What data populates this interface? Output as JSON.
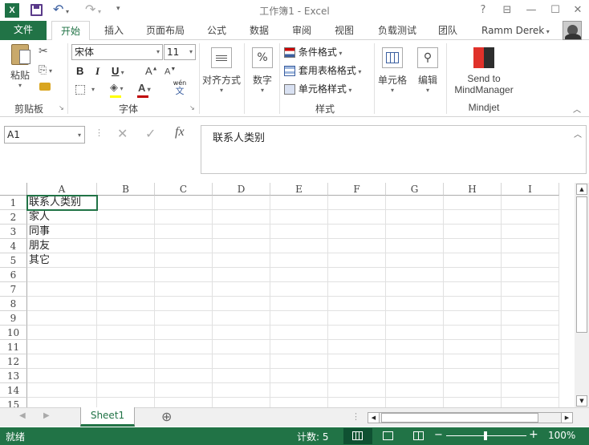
{
  "window": {
    "title": "工作簿1 - Excel",
    "help": "?",
    "minimize": "—",
    "restore": "☐",
    "close": "✕",
    "restore_ribbon": "⊟"
  },
  "tabs": {
    "file": "文件",
    "home": "开始",
    "insert": "插入",
    "layout": "页面布局",
    "formulas": "公式",
    "data": "数据",
    "review": "审阅",
    "view": "视图",
    "loadtest": "负载测试",
    "team": "团队"
  },
  "user": {
    "name": "Ramm Derek"
  },
  "ribbon": {
    "paste": "粘贴",
    "clipboard": "剪贴板",
    "font_name": "宋体",
    "font_size": "11",
    "bold": "B",
    "italic": "I",
    "underline": "U",
    "grow": "A",
    "shrink": "A",
    "font": "字体",
    "wen": "wén",
    "wen_char": "文",
    "align": "对齐方式",
    "number": "数字",
    "percent": "%",
    "cond_format": "条件格式",
    "table_format": "套用表格格式",
    "cell_style": "单元格样式",
    "styles": "样式",
    "cells": "单元格",
    "edit": "编辑",
    "send_to_line1": "Send to",
    "send_to_line2": "MindManager",
    "mindjet": "Mindjet"
  },
  "formula": {
    "namebox": "A1",
    "fx": "fx",
    "content": "联系人类别"
  },
  "columns": [
    "A",
    "B",
    "C",
    "D",
    "E",
    "F",
    "G",
    "H",
    "I"
  ],
  "rows": [
    "1",
    "2",
    "3",
    "4",
    "5",
    "6",
    "7",
    "8",
    "9",
    "10",
    "11",
    "12",
    "13",
    "14",
    "15"
  ],
  "cells": {
    "A1": "联系人类别",
    "A2": "家人",
    "A3": "同事",
    "A4": "朋友",
    "A5": "其它"
  },
  "sheet": {
    "tab": "Sheet1",
    "add": "⊕"
  },
  "status": {
    "ready": "就绪",
    "count": "计数: 5",
    "zoom_minus": "−",
    "zoom_plus": "+",
    "zoom": "100%"
  },
  "colors": {
    "accent": "#217346",
    "excel_green": "#1e7145"
  }
}
